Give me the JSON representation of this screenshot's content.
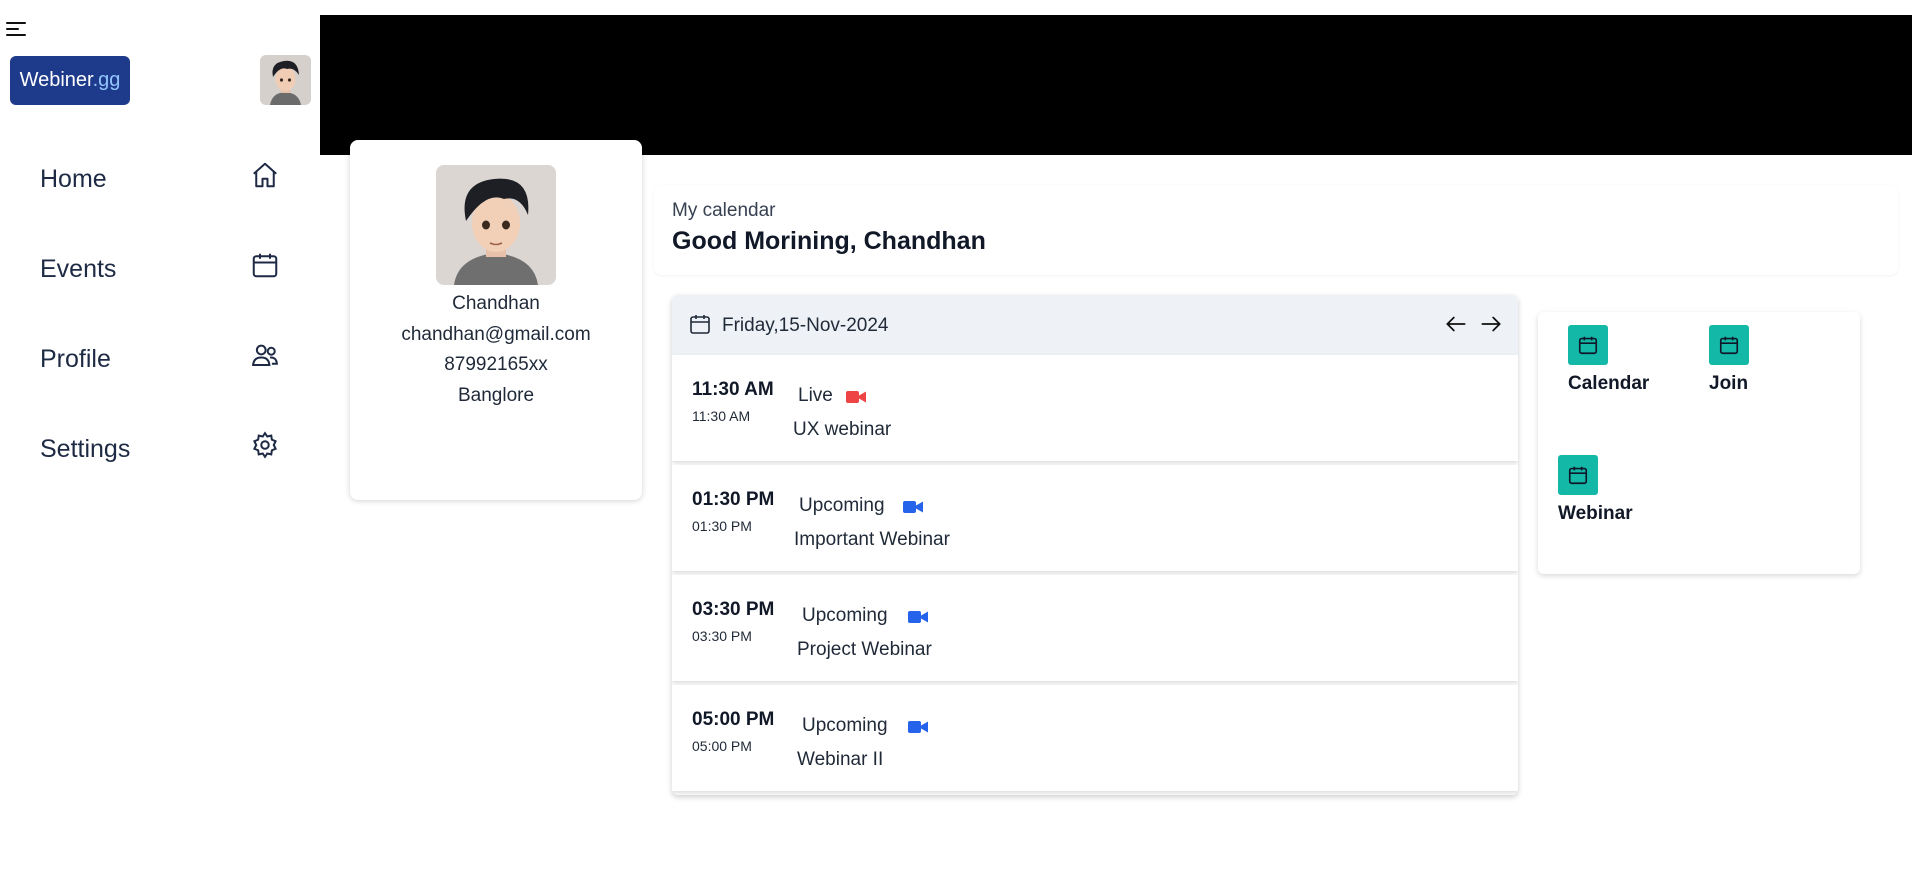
{
  "sidebar": {
    "brand_name": "Webiner",
    "brand_suffix": ".gg",
    "items": [
      {
        "label": "Home",
        "icon": "home-icon"
      },
      {
        "label": "Events",
        "icon": "calendar-icon"
      },
      {
        "label": "Profile",
        "icon": "users-icon"
      },
      {
        "label": "Settings",
        "icon": "gear-icon"
      }
    ]
  },
  "profile": {
    "name": "Chandhan",
    "email": "chandhan@gmail.com",
    "phone": "87992165xx",
    "city": "Banglore"
  },
  "greeting": {
    "subtitle": "My calendar",
    "title": "Good Morining, Chandhan"
  },
  "schedule": {
    "date": "Friday,15-Nov-2024",
    "events": [
      {
        "time": "11:30 AM",
        "time_small": "11:30 AM",
        "status": "Live",
        "status_color": "#ef4444",
        "title": "UX webinar"
      },
      {
        "time": "01:30 PM",
        "time_small": "01:30 PM",
        "status": "Upcoming",
        "status_color": "#2563eb",
        "title": "Important Webinar"
      },
      {
        "time": "03:30 PM",
        "time_small": "03:30 PM",
        "status": "Upcoming",
        "status_color": "#2563eb",
        "title": "Project Webinar"
      },
      {
        "time": "05:00 PM",
        "time_small": "05:00 PM",
        "status": "Upcoming",
        "status_color": "#2563eb",
        "title": "Webinar II"
      }
    ]
  },
  "actions": [
    {
      "label": "Calendar",
      "icon": "calendar-icon"
    },
    {
      "label": "Join",
      "icon": "calendar-icon"
    },
    {
      "label": "Webinar",
      "icon": "calendar-icon"
    }
  ],
  "colors": {
    "brand": "#1e3a8a",
    "accent_teal": "#14b8a6",
    "live": "#ef4444",
    "upcoming": "#2563eb"
  }
}
